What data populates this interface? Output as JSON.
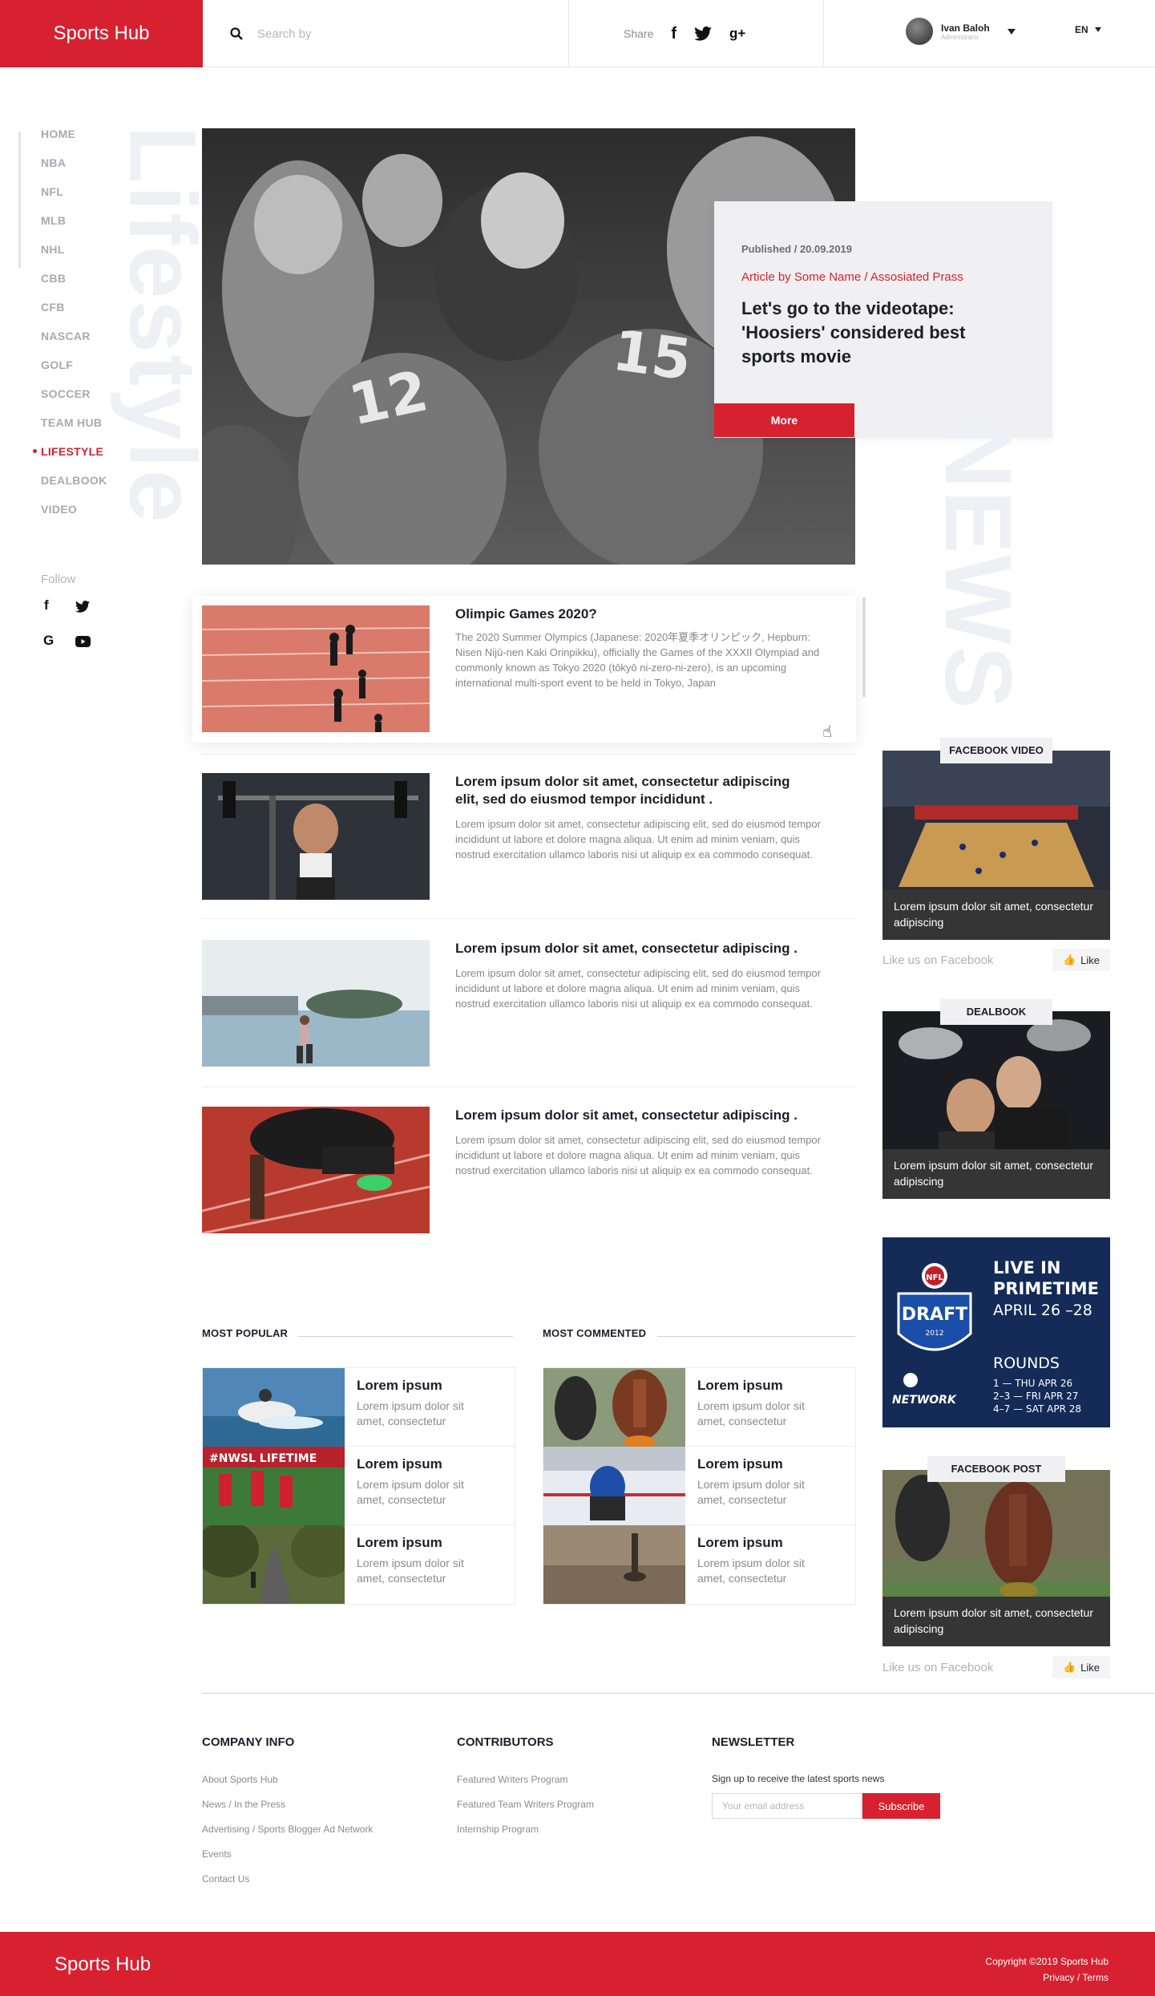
{
  "header": {
    "logo": "Sports Hub",
    "search_placeholder": "Search by",
    "share_label": "Share",
    "share_icons": [
      "facebook-icon",
      "twitter-icon",
      "google-plus-icon"
    ],
    "user_name": "Ivan Baloh",
    "user_role": "Administrator",
    "language": "EN"
  },
  "sidebar": {
    "items": [
      {
        "label": "HOME"
      },
      {
        "label": "NBA"
      },
      {
        "label": "NFL"
      },
      {
        "label": "MLB"
      },
      {
        "label": "NHL"
      },
      {
        "label": "CBB"
      },
      {
        "label": "CFB"
      },
      {
        "label": "NASCAR"
      },
      {
        "label": "GOLF"
      },
      {
        "label": "SOCCER"
      },
      {
        "label": "TEAM HUB"
      },
      {
        "label": "LIFESTYLE"
      },
      {
        "label": "DEALBOOK"
      },
      {
        "label": "VIDEO"
      }
    ],
    "active": "LIFESTYLE",
    "follow_label": "Follow",
    "follow_icons": [
      "facebook-icon",
      "twitter-icon",
      "google-icon",
      "youtube-icon"
    ]
  },
  "decor": {
    "lifestyle_word": "Lifestyle",
    "news_word": "NEWS"
  },
  "hero": {
    "published": "Published / 20.09.2019",
    "byline": "Article by Some Name / Assosiated Prass",
    "title": "Let's go to the videotape: 'Hoosiers' considered best sports movie",
    "more_label": "More"
  },
  "articles": [
    {
      "title": "Olimpic Games 2020?",
      "text": "The 2020 Summer Olympics (Japanese: 2020年夏季オリンピック, Hepburn: Nisen Nijū-nen Kaki Orinpikku), officially the Games of the XXXII Olympiad and commonly known as Tokyo 2020 (tōkyō ni-zero-ni-zero), is an upcoming international multi-sport event to be held in Tokyo, Japan"
    },
    {
      "title": "Lorem ipsum dolor sit amet, consectetur adipiscing elit, sed do eiusmod tempor incididunt .",
      "text": "Lorem ipsum dolor sit amet, consectetur adipiscing elit, sed do eiusmod tempor incididunt ut labore et dolore magna aliqua. Ut enim ad minim veniam, quis nostrud exercitation ullamco laboris nisi ut aliquip ex ea commodo consequat."
    },
    {
      "title": "Lorem ipsum dolor sit amet, consectetur adipiscing .",
      "text": "Lorem ipsum dolor sit amet, consectetur adipiscing elit, sed do eiusmod tempor incididunt ut labore et dolore magna aliqua. Ut enim ad minim veniam, quis nostrud exercitation ullamco laboris nisi ut aliquip ex ea commodo consequat."
    },
    {
      "title": "Lorem ipsum dolor sit amet, consectetur adipiscing .",
      "text": "Lorem ipsum dolor sit amet, consectetur adipiscing elit, sed do eiusmod tempor incididunt ut labore et dolore magna aliqua. Ut enim ad minim veniam, quis nostrud exercitation ullamco laboris nisi ut aliquip ex ea commodo consequat."
    }
  ],
  "most_popular": {
    "heading": "MOST POPULAR",
    "items": [
      {
        "title": "Lorem ipsum",
        "text": "Lorem ipsum dolor sit amet, consectetur"
      },
      {
        "title": "Lorem ipsum",
        "text": "Lorem ipsum dolor sit amet, consectetur"
      },
      {
        "title": "Lorem ipsum",
        "text": "Lorem ipsum dolor sit amet, consectetur"
      }
    ]
  },
  "most_commented": {
    "heading": "MOST COMMENTED",
    "items": [
      {
        "title": "Lorem ipsum",
        "text": "Lorem ipsum dolor sit amet, consectetur"
      },
      {
        "title": "Lorem ipsum",
        "text": "Lorem ipsum dolor sit amet, consectetur"
      },
      {
        "title": "Lorem ipsum",
        "text": "Lorem ipsum dolor sit amet, consectetur"
      }
    ]
  },
  "widgets": {
    "facebook_video": {
      "tag": "FACEBOOK  VIDEO",
      "caption": "Lorem ipsum dolor sit amet, consectetur adipiscing",
      "like_text": "Like us on Facebook",
      "like_label": "Like"
    },
    "dealbook": {
      "tag": "DEALBOOK",
      "caption": "Lorem ipsum dolor sit amet, consectetur adipiscing"
    },
    "ad": {
      "line1": "LIVE IN",
      "line2": "PRIMETIME",
      "line3": "APRIL 26 –28",
      "rounds": "ROUNDS",
      "r1": "1 — THU APR 26",
      "r2": "2–3 — FRI APR 27",
      "r3": "4–7 — SAT APR 28",
      "badge_top": "NFL",
      "badge": "DRAFT",
      "badge_year": "2012",
      "network": "NETWORK"
    },
    "facebook_post": {
      "tag": "FACEBOOK POST",
      "caption": "Lorem ipsum dolor sit amet, consectetur adipiscing",
      "like_text": "Like us on Facebook",
      "like_label": "Like"
    }
  },
  "footer": {
    "company": {
      "heading": "COMPANY INFO",
      "links": [
        "About Sports Hub",
        "News / In the Press",
        "Advertising / Sports Blogger Ad Network",
        "Events",
        "Contact Us"
      ]
    },
    "contributors": {
      "heading": "CONTRIBUTORS",
      "links": [
        "Featured Writers Program",
        "Featured Team Writers Program",
        "Internship Program"
      ]
    },
    "newsletter": {
      "heading": "NEWSLETTER",
      "text": "Sign up to receive the latest sports news",
      "placeholder": "Your email address",
      "button": "Subscribe"
    },
    "logo": "Sports Hub",
    "copyright": "Copyright ©2019 Sports Hub",
    "links": "Privacy / Terms"
  },
  "colors": {
    "brand": "#d72130",
    "dark": "#1e1e2a",
    "caption_bg": "#353535",
    "ad_bg": "#16305e"
  }
}
